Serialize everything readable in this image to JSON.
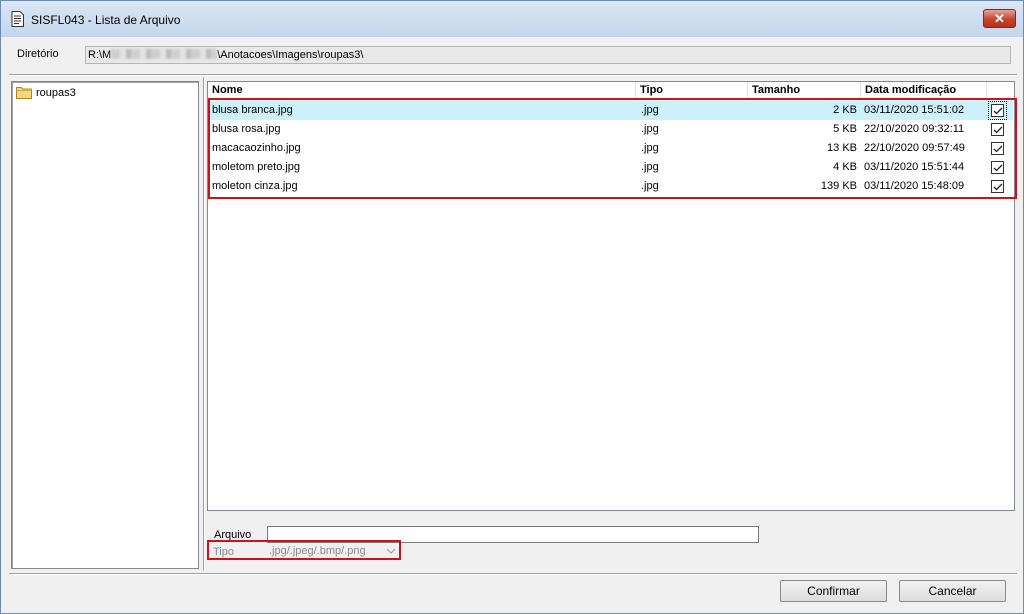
{
  "window": {
    "title": "SISFL043 - Lista de Arquivo",
    "close_label": "✕"
  },
  "directory": {
    "label": "Diretório",
    "value_prefix": "R:\\M",
    "value_suffix": "\\Anotacoes\\Imagens\\roupas3\\"
  },
  "tree": {
    "items": [
      {
        "label": "roupas3"
      }
    ]
  },
  "file_list": {
    "columns": [
      "Nome",
      "Tipo",
      "Tamanho",
      "Data modificação"
    ],
    "rows": [
      {
        "name": "blusa branca.jpg",
        "type": ".jpg",
        "size": "2 KB",
        "modified": "03/11/2020 15:51:02",
        "checked": true,
        "selected": true
      },
      {
        "name": "blusa rosa.jpg",
        "type": ".jpg",
        "size": "5 KB",
        "modified": "22/10/2020 09:32:11",
        "checked": true,
        "selected": false
      },
      {
        "name": "macacaozinho.jpg",
        "type": ".jpg",
        "size": "13 KB",
        "modified": "22/10/2020 09:57:49",
        "checked": true,
        "selected": false
      },
      {
        "name": "moletom preto.jpg",
        "type": ".jpg",
        "size": "4 KB",
        "modified": "03/11/2020 15:51:44",
        "checked": true,
        "selected": false
      },
      {
        "name": "moleton cinza.jpg",
        "type": ".jpg",
        "size": "139 KB",
        "modified": "03/11/2020 15:48:09",
        "checked": true,
        "selected": false
      }
    ]
  },
  "form": {
    "arquivo_label": "Arquivo",
    "arquivo_value": "",
    "tipo_label": "Tipo",
    "tipo_value": ".jpg/.jpeg/.bmp/.png"
  },
  "buttons": {
    "confirm": "Confirmar",
    "cancel": "Cancelar"
  },
  "colors": {
    "highlight_box": "#d0101a",
    "selected_row": "#cdf1fb"
  }
}
